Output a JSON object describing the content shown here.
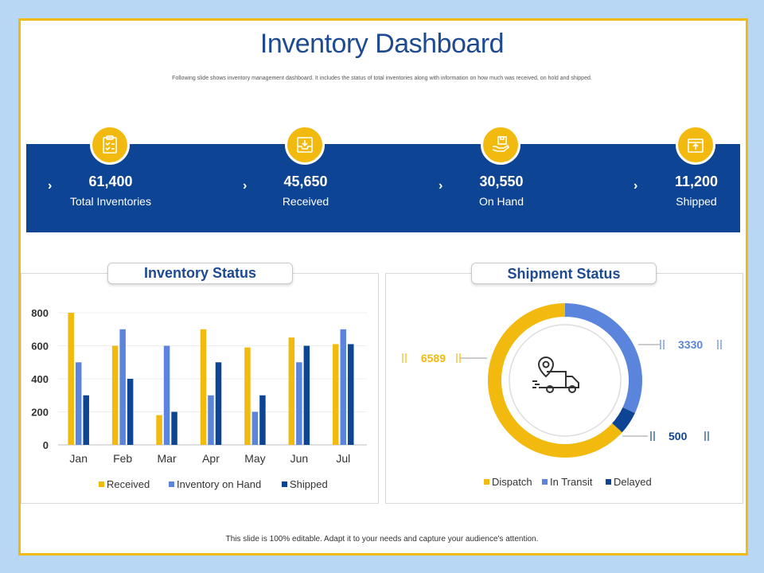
{
  "title": "Inventory Dashboard",
  "subtitle": "Following slide shows inventory management dashboard. It includes the status of total inventories along with information on how much was received, on hold and shipped.",
  "kpis": [
    {
      "value": "61,400",
      "label": "Total Inventories",
      "icon": "clipboard-checklist-icon"
    },
    {
      "value": "45,650",
      "label": "Received",
      "icon": "inbox-download-icon"
    },
    {
      "value": "30,550",
      "label": "On Hand",
      "icon": "hand-box-icon"
    },
    {
      "value": "11,200",
      "label": "Shipped",
      "icon": "box-upload-icon"
    }
  ],
  "inventory_panel": {
    "title": "Inventory Status"
  },
  "shipment_panel": {
    "title": "Shipment Status"
  },
  "footer": "This slide is 100% editable. Adapt it to your needs and capture your audience's attention.",
  "colors": {
    "accent": "#f2b90f",
    "navy": "#0d4594",
    "blue": "#5b84dc",
    "dark_blue": "#0d4594"
  },
  "chart_data": [
    {
      "type": "bar",
      "title": "Inventory Status",
      "categories": [
        "Jan",
        "Feb",
        "Mar",
        "Apr",
        "May",
        "Jun",
        "Jul"
      ],
      "ylim": [
        0,
        800
      ],
      "yticks": [
        0,
        200,
        400,
        600,
        800
      ],
      "legend_position": "bottom",
      "series": [
        {
          "name": "Received",
          "color": "#f2b90f",
          "values": [
            800,
            600,
            180,
            700,
            590,
            650,
            610
          ]
        },
        {
          "name": "Inventory on Hand",
          "color": "#5b84dc",
          "values": [
            500,
            700,
            600,
            300,
            200,
            500,
            700
          ]
        },
        {
          "name": "Shipped",
          "color": "#0d4594",
          "values": [
            300,
            400,
            200,
            500,
            300,
            600,
            610
          ]
        }
      ]
    },
    {
      "type": "pie",
      "title": "Shipment Status",
      "donut": true,
      "center_icon": "delivery-truck-location-icon",
      "legend_position": "bottom",
      "slices": [
        {
          "name": "Dispatch",
          "value": 6589,
          "color": "#f2b90f"
        },
        {
          "name": "In Transit",
          "value": 3330,
          "color": "#5b84dc"
        },
        {
          "name": "Delayed",
          "value": 500,
          "color": "#0d4594"
        }
      ]
    }
  ]
}
